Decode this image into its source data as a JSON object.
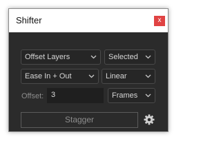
{
  "window": {
    "title": "Shifter",
    "close_glyph": "x"
  },
  "row1": {
    "mode": "Offset Layers",
    "scope": "Selected"
  },
  "row2": {
    "easing": "Ease In + Out",
    "interpolation": "Linear"
  },
  "offset": {
    "label": "Offset:",
    "value": "3",
    "unit": "Frames"
  },
  "actions": {
    "stagger_label": "Stagger",
    "settings_icon": "gear-icon"
  },
  "colors": {
    "panel": "#2b2b2b",
    "close": "#e04343",
    "text": "#d6d6d6"
  }
}
